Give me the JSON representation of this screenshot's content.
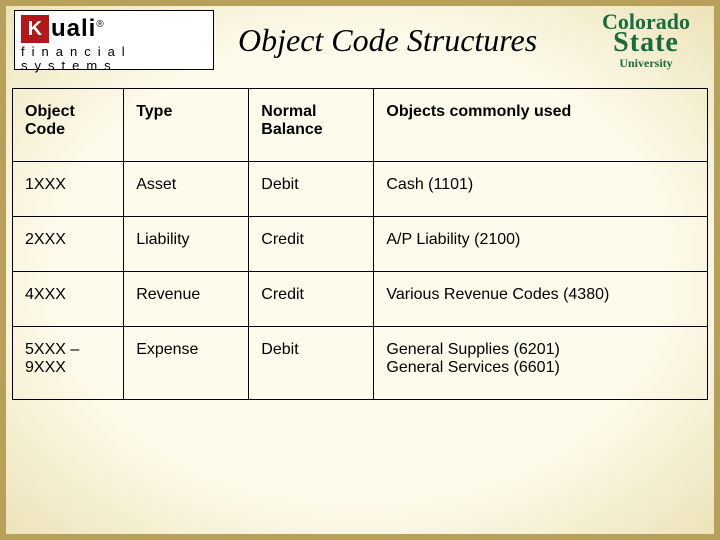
{
  "header": {
    "kuali_k": "K",
    "kuali_word": "uali",
    "kuali_reg": "®",
    "kuali_sub": "financial systems",
    "title": "Object Code Structures",
    "csu_line1": "Colorado",
    "csu_line2": "State",
    "csu_line3": "University"
  },
  "table": {
    "headers": {
      "c1": "Object Code",
      "c2": "Type",
      "c3": "Normal Balance",
      "c4": "Objects commonly used"
    },
    "rows": [
      {
        "code": "1XXX",
        "type": "Asset",
        "balance": "Debit",
        "usage_a": "Cash (1101)",
        "usage_b": ""
      },
      {
        "code": "2XXX",
        "type": "Liability",
        "balance": "Credit",
        "usage_a": "A/P Liability (2100)",
        "usage_b": ""
      },
      {
        "code": "4XXX",
        "type": "Revenue",
        "balance": "Credit",
        "usage_a": "Various Revenue Codes (4380)",
        "usage_b": ""
      },
      {
        "code": "5XXX – 9XXX",
        "type": "Expense",
        "balance": "Debit",
        "usage_a": "General Supplies (6201)",
        "usage_b": "General Services (6601)"
      }
    ]
  }
}
